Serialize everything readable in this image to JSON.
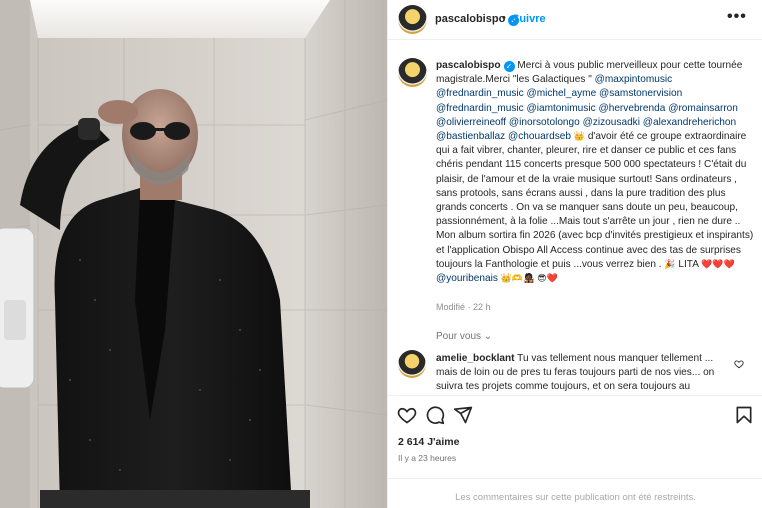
{
  "post": {
    "username": "pascalobispo",
    "follow_label": "Suivre",
    "separator": "•",
    "more_label": "•••"
  },
  "caption": {
    "author": "pascalobispo",
    "segments": [
      {
        "t": "text",
        "v": "Merci à vous public merveilleux pour cette tournée magistrale.Merci \"les Galactiques \" "
      },
      {
        "t": "mention",
        "v": "@maxpintomusic"
      },
      {
        "t": "text",
        "v": " "
      },
      {
        "t": "mention",
        "v": "@frednardin_music"
      },
      {
        "t": "text",
        "v": " "
      },
      {
        "t": "mention",
        "v": "@michel_ayme"
      },
      {
        "t": "text",
        "v": " "
      },
      {
        "t": "mention",
        "v": "@samstonervision"
      },
      {
        "t": "text",
        "v": " "
      },
      {
        "t": "mention",
        "v": "@frednardin_music"
      },
      {
        "t": "text",
        "v": " "
      },
      {
        "t": "mention",
        "v": "@iamtonimusic"
      },
      {
        "t": "text",
        "v": " "
      },
      {
        "t": "mention",
        "v": "@hervebrenda"
      },
      {
        "t": "text",
        "v": " "
      },
      {
        "t": "mention",
        "v": "@romainsarron"
      },
      {
        "t": "text",
        "v": " "
      },
      {
        "t": "mention",
        "v": "@olivierreineoff"
      },
      {
        "t": "text",
        "v": " "
      },
      {
        "t": "mention",
        "v": "@inorsotolongo"
      },
      {
        "t": "text",
        "v": " "
      },
      {
        "t": "mention",
        "v": "@zizousadki"
      },
      {
        "t": "text",
        "v": " "
      },
      {
        "t": "mention",
        "v": "@alexandreherichon"
      },
      {
        "t": "text",
        "v": " "
      },
      {
        "t": "mention",
        "v": "@bastienballaz"
      },
      {
        "t": "text",
        "v": " "
      },
      {
        "t": "mention",
        "v": "@chouardseb"
      },
      {
        "t": "text",
        "v": " "
      },
      {
        "t": "emoji",
        "v": "👑"
      },
      {
        "t": "text",
        "v": " d'avoir été ce groupe extraordinaire qui a fait vibrer, chanter, pleurer, rire et danser ce public et ces fans chéris pendant 115 concerts presque 500 000 spectateurs ! C'était du plaisir, de l'amour et de la vraie musique surtout! Sans ordinateurs , sans protools, sans écrans aussi , dans la pure tradition des plus grands concerts . On va se manquer sans doute un peu, beaucoup, passionnément, à la folie ...Mais tout s'arrête un jour , rien ne dure .. Mon album sortira fin 2026 (avec bcp d'invités prestigieux et inspirants) et l'application Obispo All Access continue avec des tas de surprises toujours la Fanthologie et puis ...vous verrez bien . "
      },
      {
        "t": "emoji",
        "v": "🎉"
      },
      {
        "t": "text",
        "v": " LITA "
      },
      {
        "t": "emoji",
        "v": "❤️❤️❤️"
      },
      {
        "t": "text",
        "v": " "
      },
      {
        "t": "mention",
        "v": "@youribenais"
      },
      {
        "t": "text",
        "v": " "
      },
      {
        "t": "emoji",
        "v": "👑🫶🧑🏿‍🎤"
      },
      {
        "t": "text",
        "v": " "
      },
      {
        "t": "emoji",
        "v": "😎❤️"
      }
    ],
    "modified_label": "Modifié · 22 h"
  },
  "translate_label": "Pour vous ⌄",
  "comment": {
    "author": "amelie_bocklant",
    "text": " Tu vas tellement nous manquer tellement ... mais de loin ou de pres tu feras toujours parti de nos vies... on suivra tes projets comme toujours, et on sera toujours au"
  },
  "likes_label": "2 614 J'aime",
  "posted_label": "Il y a 23 heures",
  "restricted_label": "Les commentaires sur cette publication ont été restreints.",
  "icons": [
    "heart-icon",
    "comment-icon",
    "share-icon",
    "bookmark-icon",
    "verified-icon",
    "more-icon"
  ],
  "colors": {
    "link": "#0095f6",
    "mention": "#00376b",
    "muted": "#737373",
    "divider": "#efefef"
  }
}
